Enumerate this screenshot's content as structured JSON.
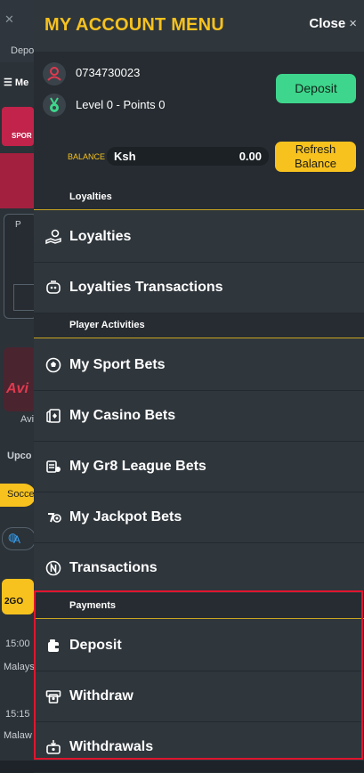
{
  "background": {
    "depo_label": "Depo",
    "menu_label": "Me",
    "sports_label": "SPOR",
    "card_label": "P",
    "game_label": "Avi",
    "game_logo": "Avi",
    "upcoming_label": "Upco",
    "soccer_chip": "Socce",
    "globe_chip": "A",
    "promo_logo": "2GO",
    "time_1": "15:00",
    "league_1": "Malays",
    "time_2": "15:15",
    "league_2": "Malaw"
  },
  "drawer": {
    "title": "MY ACCOUNT MENU",
    "close_label": "Close",
    "close_icon": "×",
    "phone": "0734730023",
    "level": "Level 0 - Points 0",
    "deposit_button": "Deposit",
    "balance_label": "BALANCE",
    "currency": "Ksh",
    "balance_amount": "0.00",
    "refresh_button_line1": "Refresh",
    "refresh_button_line2": "Balance"
  },
  "sections": {
    "loyalties_header": "Loyalties",
    "player_activities_header": "Player Activities",
    "payments_header": "Payments"
  },
  "menu": {
    "loyalties": "Loyalties",
    "loyalties_transactions": "Loyalties Transactions",
    "my_sport_bets": "My Sport Bets",
    "my_casino_bets": "My Casino Bets",
    "my_gr8_league_bets": "My Gr8 League Bets",
    "my_jackpot_bets": "My Jackpot Bets",
    "transactions": "Transactions",
    "deposit": "Deposit",
    "withdraw": "Withdraw",
    "withdrawals": "Withdrawals"
  },
  "colors": {
    "accent_yellow": "#f7c21e",
    "deposit_green": "#3ed68c",
    "highlight_red": "#e0152e",
    "drawer_bg": "#2f363c"
  },
  "icons": {
    "user": "user-icon",
    "medal": "medal-icon",
    "loyalty": "hand-coin-icon",
    "loyalty_tx": "piggy-icon",
    "sport": "soccer-ball-icon",
    "casino": "cards-icon",
    "gr8": "league-icon",
    "jackpot": "jackpot-icon",
    "transactions": "coin-icon",
    "deposit": "wallet-icon",
    "withdraw": "atm-icon",
    "withdrawals": "cash-box-icon"
  }
}
